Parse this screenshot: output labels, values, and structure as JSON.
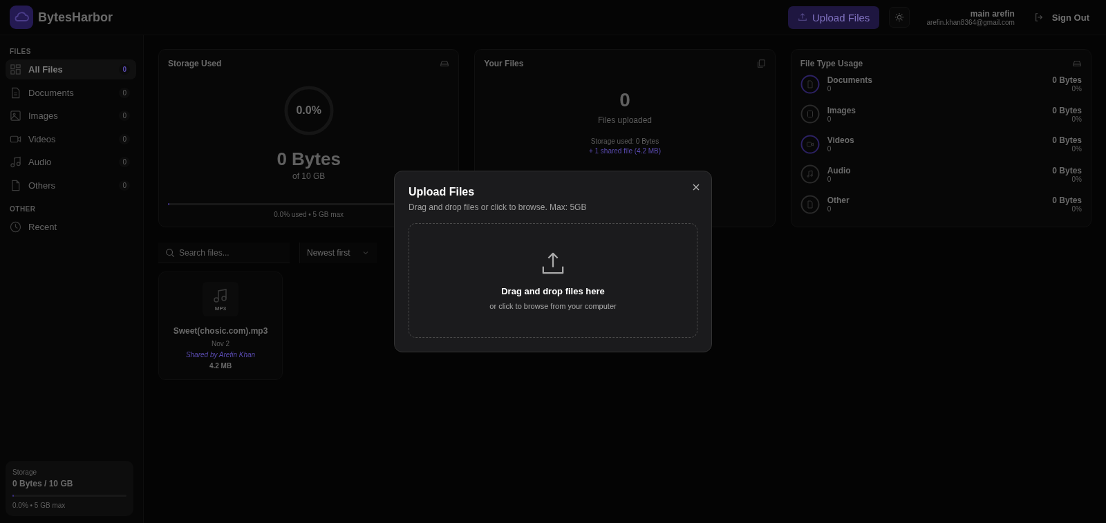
{
  "header": {
    "brand": "BytesHarbor",
    "upload_button": "Upload Files",
    "user": {
      "name": "main arefin",
      "email": "arefin.khan8364@gmail.com"
    },
    "sign_out": "Sign Out"
  },
  "sidebar": {
    "sections": [
      {
        "title": "FILES",
        "items": [
          {
            "kind": "grid",
            "label": "All Files",
            "count": "0",
            "selected": true
          },
          {
            "kind": "document",
            "label": "Documents",
            "count": "0",
            "selected": false
          },
          {
            "kind": "image",
            "label": "Images",
            "count": "0",
            "selected": false
          },
          {
            "kind": "video",
            "label": "Videos",
            "count": "0",
            "selected": false
          },
          {
            "kind": "audio",
            "label": "Audio",
            "count": "0",
            "selected": false
          },
          {
            "kind": "file",
            "label": "Others",
            "count": "0",
            "selected": false
          }
        ]
      },
      {
        "title": "OTHER",
        "items": [
          {
            "kind": "clock",
            "label": "Recent",
            "selected": false
          }
        ]
      }
    ],
    "storage": {
      "title": "Storage",
      "value": "0 Bytes / 10 GB",
      "level": 0,
      "note": "0.0% • 5 GB max"
    }
  },
  "storage_card": {
    "title": "Storage Used",
    "ring": {
      "level": 0,
      "percent": "0.0%"
    },
    "amount": "0 Bytes",
    "of": "of 10 GB",
    "bar": {
      "level": 0
    },
    "note": "0.0% used • 5 GB max"
  },
  "files_card": {
    "title": "Your Files",
    "count": "0",
    "caption": "Files uploaded",
    "storage_used": "Storage used: 0 Bytes",
    "shared": "+ 1 shared file (4.2 MB)"
  },
  "file_types": {
    "title": "File Type Usage",
    "items": [
      {
        "kind": "document",
        "label": "Documents",
        "count": "0",
        "size": "0 Bytes",
        "percent": "0%",
        "color": "#2c2163"
      },
      {
        "kind": "image",
        "label": "Images",
        "count": "0",
        "size": "0 Bytes",
        "percent": "0%",
        "color": "#2a2a2a"
      },
      {
        "kind": "video",
        "label": "Videos",
        "count": "0",
        "size": "0 Bytes",
        "percent": "0%",
        "color": "#2c2163"
      },
      {
        "kind": "audio",
        "label": "Audio",
        "count": "0",
        "size": "0 Bytes",
        "percent": "0%",
        "color": "#2a2a2a"
      },
      {
        "kind": "file",
        "label": "Other",
        "count": "0",
        "size": "0 Bytes",
        "percent": "0%",
        "color": "#2a2a2a"
      }
    ]
  },
  "search": {
    "placeholder": "Search files..."
  },
  "sort": {
    "value": "Newest first"
  },
  "files": [
    {
      "kind": "audio",
      "type": "MP3",
      "name": "Sweet(chosic.com).mp3",
      "date": "Nov 2",
      "shared_by": "Shared by Arefin Khan",
      "size": "4.2 MB"
    }
  ],
  "modal": {
    "title": "Upload Files",
    "subtitle": "Drag and drop files or click to browse. Max: 5GB",
    "drop_title": "Drag and drop files here",
    "drop_hint": "or click to browse from your computer"
  }
}
